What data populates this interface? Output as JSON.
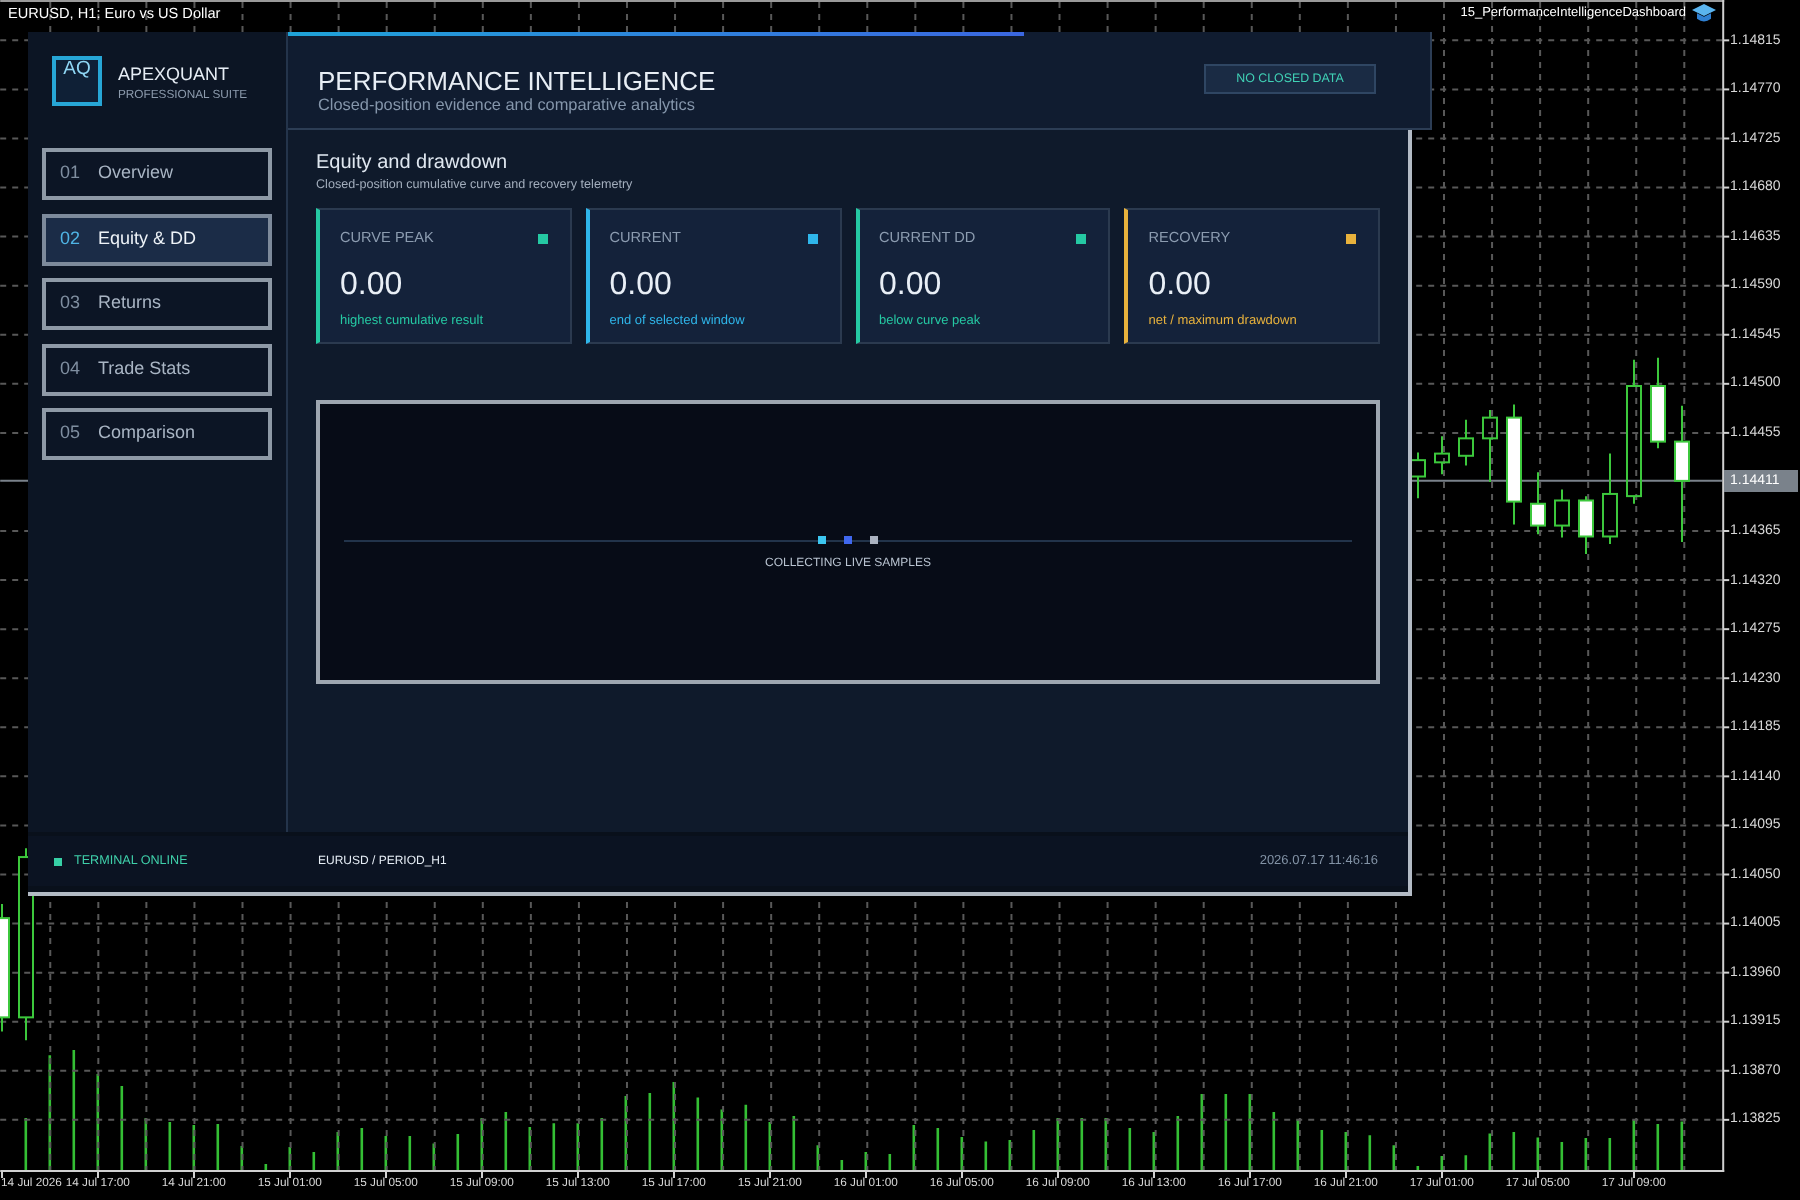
{
  "chart": {
    "indicator": "15_PerformanceIntelligenceDashboard",
    "first_bar_date": "14 Jul 2026",
    "chart_data": {
      "type": "candlestick",
      "title": "EURUSD, H1: Euro vs US Dollar",
      "grid": true,
      "categories": [
        null,
        null,
        null,
        null,
        "14 Jul 17:00",
        null,
        null,
        null,
        "14 Jul 21:00",
        null,
        null,
        null,
        "15 Jul 01:00",
        null,
        null,
        null,
        "15 Jul 05:00",
        null,
        null,
        null,
        "15 Jul 09:00",
        null,
        null,
        null,
        "15 Jul 13:00",
        null,
        null,
        null,
        "15 Jul 17:00",
        null,
        null,
        null,
        "15 Jul 21:00",
        null,
        null,
        null,
        "16 Jul 01:00",
        null,
        null,
        null,
        "16 Jul 05:00",
        null,
        null,
        null,
        "16 Jul 09:00",
        null,
        null,
        null,
        "16 Jul 13:00",
        null,
        null,
        null,
        "16 Jul 17:00",
        null,
        null,
        null,
        "16 Jul 21:00",
        null,
        null,
        null,
        "17 Jul 01:00",
        null,
        null,
        null,
        "17 Jul 05:00",
        null,
        null,
        null,
        "17 Jul 09:00",
        null,
        null
      ],
      "ohlc": [
        [
          1.1401,
          1.14023,
          1.13906,
          1.13919
        ],
        [
          1.13919,
          1.14074,
          1.13898,
          1.14066
        ],
        null,
        null,
        null,
        null,
        null,
        null,
        null,
        null,
        null,
        null,
        null,
        null,
        null,
        null,
        null,
        null,
        null,
        null,
        null,
        null,
        null,
        null,
        null,
        null,
        null,
        null,
        null,
        null,
        null,
        null,
        null,
        null,
        null,
        null,
        null,
        null,
        null,
        null,
        null,
        null,
        null,
        null,
        null,
        null,
        null,
        null,
        null,
        null,
        null,
        null,
        null,
        null,
        null,
        null,
        null,
        null,
        null,
        [
          1.14415,
          1.14437,
          1.14395,
          1.1443
        ],
        [
          1.14428,
          1.14452,
          1.14417,
          1.14436
        ],
        [
          1.14434,
          1.14467,
          1.14425,
          1.1445
        ],
        [
          1.1445,
          1.14476,
          1.1441,
          1.14469
        ],
        [
          1.14469,
          1.14481,
          1.14371,
          1.14392
        ],
        [
          1.1439,
          1.14419,
          1.14362,
          1.1437
        ],
        [
          1.1437,
          1.14403,
          1.14359,
          1.14393
        ],
        [
          1.14393,
          1.14397,
          1.14344,
          1.1436
        ],
        [
          1.1436,
          1.14436,
          1.14353,
          1.14399
        ],
        [
          1.14397,
          1.14522,
          1.1439,
          1.14498
        ],
        [
          1.14498,
          1.14524,
          1.14441,
          1.14447
        ],
        [
          1.14447,
          1.1448,
          1.14355,
          1.14411
        ]
      ],
      "ylim": [
        1.13779,
        1.14852
      ],
      "yticks": [
        {
          "value": 1.14815,
          "label": "1.14815"
        },
        {
          "value": 1.1477,
          "label": "1.14770"
        },
        {
          "value": 1.14725,
          "label": "1.14725"
        },
        {
          "value": 1.1468,
          "label": "1.14680"
        },
        {
          "value": 1.14635,
          "label": "1.14635"
        },
        {
          "value": 1.1459,
          "label": "1.14590"
        },
        {
          "value": 1.14545,
          "label": "1.14545"
        },
        {
          "value": 1.145,
          "label": "1.14500"
        },
        {
          "value": 1.14455,
          "label": "1.14455"
        },
        {
          "value": 1.14365,
          "label": "1.14365"
        },
        {
          "value": 1.1432,
          "label": "1.14320"
        },
        {
          "value": 1.14275,
          "label": "1.14275"
        },
        {
          "value": 1.1423,
          "label": "1.14230"
        },
        {
          "value": 1.14185,
          "label": "1.14185"
        },
        {
          "value": 1.1414,
          "label": "1.14140"
        },
        {
          "value": 1.14095,
          "label": "1.14095"
        },
        {
          "value": 1.1405,
          "label": "1.14050"
        },
        {
          "value": 1.14005,
          "label": "1.14005"
        },
        {
          "value": 1.1396,
          "label": "1.13960"
        },
        {
          "value": 1.13915,
          "label": "1.13915"
        },
        {
          "value": 1.1387,
          "label": "1.13870"
        },
        {
          "value": 1.13825,
          "label": "1.13825"
        }
      ],
      "ref_lines": [
        {
          "axis": "y",
          "value": 1.14411,
          "label": "1.14411",
          "color": "#7a828b"
        }
      ]
    }
  },
  "dashboard": {
    "brand": {
      "logo": "AQ",
      "name": "APEXQUANT",
      "tagline": "PROFESSIONAL SUITE"
    },
    "nav": [
      {
        "number": "01",
        "label": "Overview",
        "selected": false
      },
      {
        "number": "02",
        "label": "Equity & DD",
        "selected": true
      },
      {
        "number": "03",
        "label": "Returns",
        "selected": false
      },
      {
        "number": "04",
        "label": "Trade Stats",
        "selected": false
      },
      {
        "number": "05",
        "label": "Comparison",
        "selected": false
      }
    ],
    "header": {
      "title": "PERFORMANCE INTELLIGENCE",
      "subtitle": "Closed-position evidence and comparative analytics",
      "badge": "NO CLOSED DATA"
    },
    "section": {
      "title": "Equity and drawdown",
      "subtitle": "Closed-position cumulative curve and recovery telemetry"
    },
    "cards": [
      {
        "label": "CURVE PEAK",
        "value": "0.00",
        "caption": "highest cumulative result",
        "color": "#25c9a3"
      },
      {
        "label": "CURRENT",
        "value": "0.00",
        "caption": "end of selected window",
        "color": "#2fb6ea"
      },
      {
        "label": "CURRENT DD",
        "value": "0.00",
        "caption": "below curve peak",
        "color": "#25c9a3"
      },
      {
        "label": "RECOVERY",
        "value": "0.00",
        "caption": "net / maximum drawdown",
        "color": "#e8b23c"
      }
    ],
    "equity_chart": {
      "message": "COLLECTING LIVE SAMPLES"
    },
    "status_bar": {
      "connection": "TERMINAL ONLINE",
      "symbol": "EURUSD / PERIOD_H1",
      "timestamp": "2026.07.17 11:46:16"
    }
  }
}
